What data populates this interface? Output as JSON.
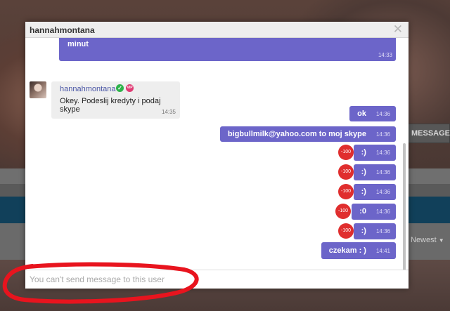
{
  "background": {
    "message_button_label": "MESSAGE",
    "sort_label": "Newest"
  },
  "modal": {
    "title": "hannahmontana",
    "close_icon": "close-icon"
  },
  "messages": [
    {
      "type": "out",
      "text": "minut",
      "time": "14:33"
    },
    {
      "type": "in",
      "author": "hannahmontana",
      "badges": [
        "verified-icon",
        "vip-icon"
      ],
      "vip_label": "VIP",
      "text": "Okey. Podeslij kredyty i podaj skype",
      "time": "14:35"
    },
    {
      "type": "out",
      "text": "ok",
      "time": "14:36"
    },
    {
      "type": "out",
      "text": "bigbullmilk@yahoo.com to moj skype",
      "time": "14:36"
    },
    {
      "type": "out",
      "text": ":)",
      "time": "14:36",
      "badge": "-100"
    },
    {
      "type": "out",
      "text": ":)",
      "time": "14:36",
      "badge": "-100"
    },
    {
      "type": "out",
      "text": ":)",
      "time": "14:36",
      "badge": "-100"
    },
    {
      "type": "out",
      "text": ":0",
      "time": "14:36",
      "badge": "-100"
    },
    {
      "type": "out",
      "text": ":)",
      "time": "14:36",
      "badge": "-100"
    },
    {
      "type": "out",
      "text": "czekam : )",
      "time": "14:41"
    }
  ],
  "input": {
    "placeholder": "You can't send message to this user",
    "value": ""
  },
  "colors": {
    "outgoing_bubble": "#6c65c9",
    "incoming_bubble": "#eeeeee",
    "badge": "#e02e2e",
    "annotation": "#e8141e"
  }
}
